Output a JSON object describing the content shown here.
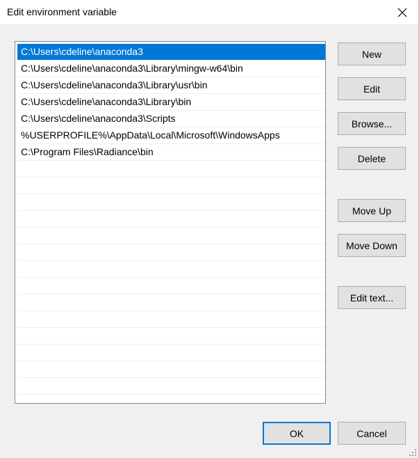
{
  "window": {
    "title": "Edit environment variable"
  },
  "entries": [
    "C:\\Users\\cdeline\\anaconda3",
    "C:\\Users\\cdeline\\anaconda3\\Library\\mingw-w64\\bin",
    "C:\\Users\\cdeline\\anaconda3\\Library\\usr\\bin",
    "C:\\Users\\cdeline\\anaconda3\\Library\\bin",
    "C:\\Users\\cdeline\\anaconda3\\Scripts",
    "%USERPROFILE%\\AppData\\Local\\Microsoft\\WindowsApps",
    "C:\\Program Files\\Radiance\\bin"
  ],
  "selected_index": 0,
  "buttons": {
    "new": "New",
    "edit": "Edit",
    "browse": "Browse...",
    "delete": "Delete",
    "move_up": "Move Up",
    "move_down": "Move Down",
    "edit_text": "Edit text...",
    "ok": "OK",
    "cancel": "Cancel"
  },
  "colors": {
    "selection": "#0078d7",
    "button_face": "#e1e1e1",
    "dialog_bg": "#f0f0f0"
  }
}
